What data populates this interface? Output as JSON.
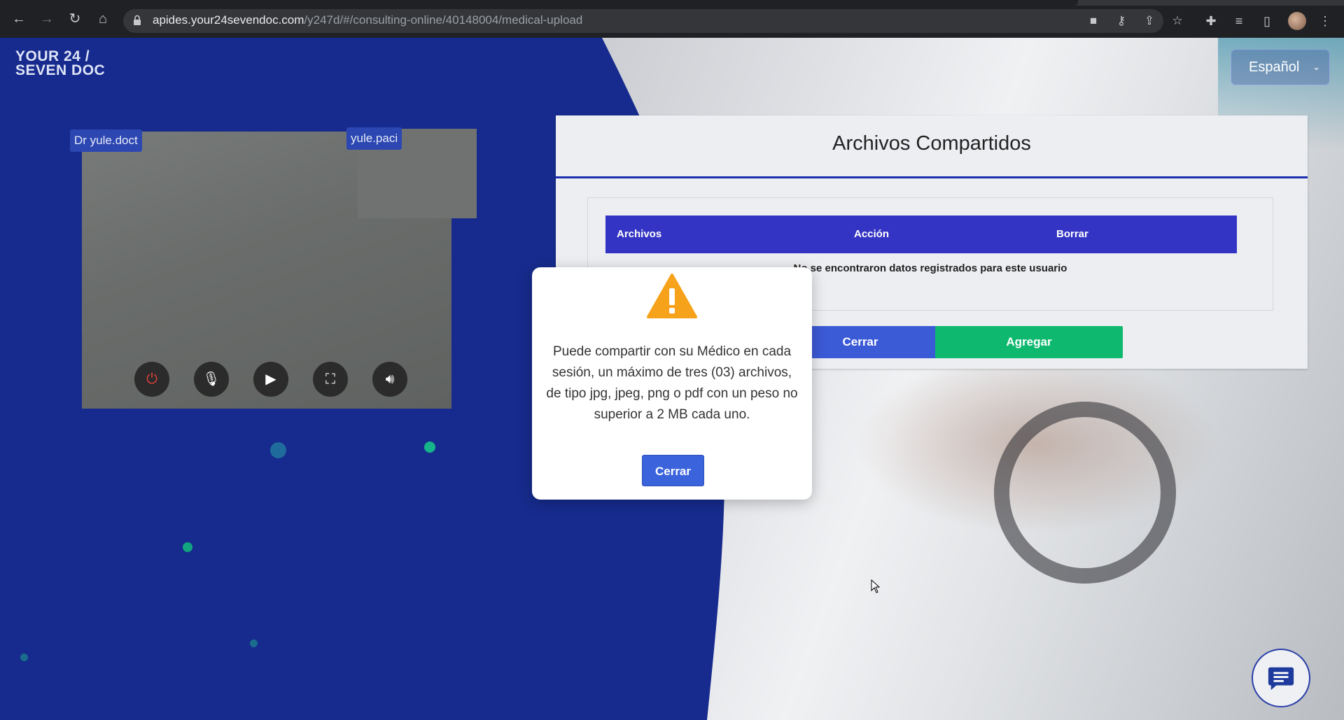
{
  "browser": {
    "url_host": "apides.your24sevendoc.com",
    "url_path": "/y247d/#/consulting-online/40148004/medical-upload"
  },
  "header": {
    "logo_line1": "YOUR 24 /",
    "logo_line2": "SEVEN DOC",
    "language": "Español"
  },
  "video": {
    "doctor_name": "Dr yule.doct",
    "patient_name": "yule.paci"
  },
  "shared_files": {
    "title": "Archivos Compartidos",
    "columns": [
      "Archivos",
      "Acción",
      "Borrar"
    ],
    "empty_message": "No se encontraron datos registrados para este usuario",
    "close_button": "Cerrar",
    "add_button": "Agregar"
  },
  "modal": {
    "message": "Puede compartir con su Médico en cada sesión, un máximo de tres (03) archivos, de tipo jpg, jpeg, png o pdf con un peso no superior a 2 MB cada uno.",
    "close_button": "Cerrar"
  },
  "colors": {
    "brand_blue": "#162b8d",
    "table_header": "#3434c4",
    "add_green": "#0fb86f",
    "close_blue": "#3b63dc",
    "warning": "#f7a21b"
  }
}
